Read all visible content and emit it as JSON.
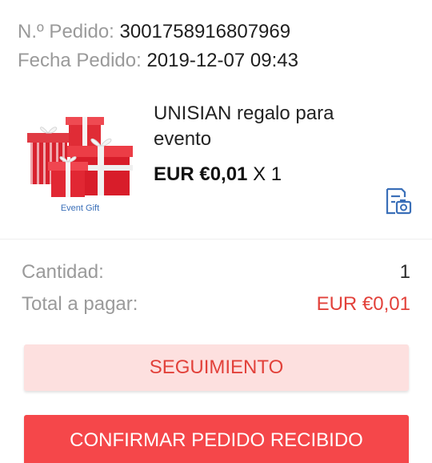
{
  "order": {
    "number_label": "N.º Pedido:",
    "number_value": "3001758916807969",
    "date_label": "Fecha Pedido:",
    "date_value": "2019-12-07 09:43"
  },
  "product": {
    "thumb_caption": "Event Gift",
    "title": "UNISIAN regalo para evento",
    "price": "EUR €0,01",
    "quantity": "X 1",
    "snapshot_icon": "order-snapshot-icon"
  },
  "summary": {
    "quantity_label": "Cantidad:",
    "quantity_value": "1",
    "total_label": "Total a pagar:",
    "total_value": "EUR €0,01"
  },
  "actions": {
    "track_label": "SEGUIMIENTO",
    "confirm_label": "CONFIRMAR PEDIDO RECIBIDO"
  },
  "colors": {
    "accent": "#e2413a",
    "confirm_bg": "#f5474a",
    "track_bg": "#fde0df",
    "icon_blue": "#3a6fb8"
  }
}
